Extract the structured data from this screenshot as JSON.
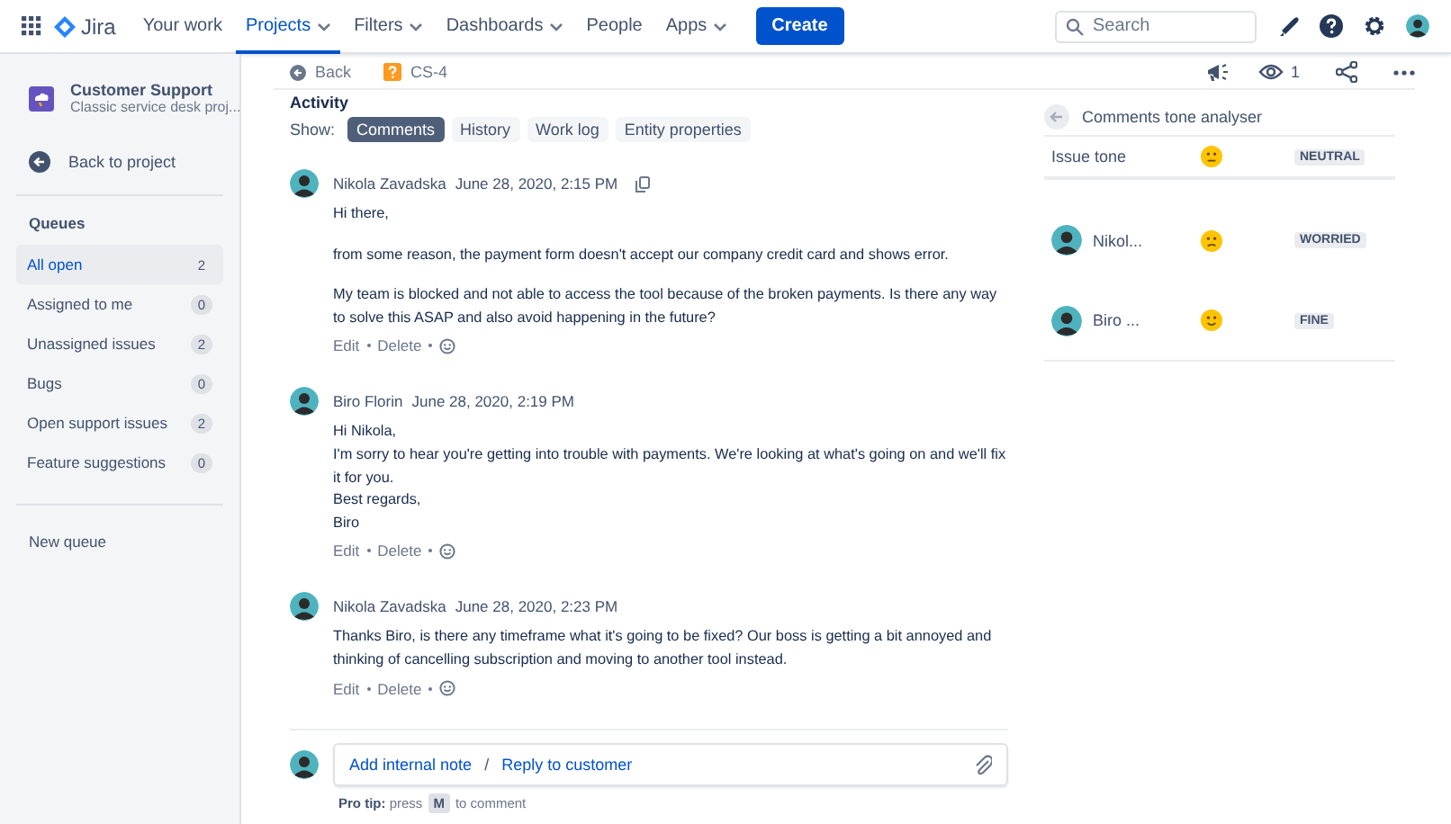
{
  "topnav": {
    "product": "Jira",
    "items": [
      {
        "label": "Your work",
        "selected": false,
        "dropdown": false
      },
      {
        "label": "Projects",
        "selected": true,
        "dropdown": true
      },
      {
        "label": "Filters",
        "selected": false,
        "dropdown": true
      },
      {
        "label": "Dashboards",
        "selected": false,
        "dropdown": true
      },
      {
        "label": "People",
        "selected": false,
        "dropdown": false
      },
      {
        "label": "Apps",
        "selected": false,
        "dropdown": true
      }
    ],
    "create": "Create",
    "search": {
      "placeholder": "Search"
    }
  },
  "sidebar": {
    "project": {
      "name": "Customer Support",
      "type": "Classic service desk proj..."
    },
    "back": "Back to project",
    "queues_heading": "Queues",
    "queues": [
      {
        "label": "All open",
        "count": "2",
        "selected": true
      },
      {
        "label": "Assigned to me",
        "count": "0",
        "selected": false
      },
      {
        "label": "Unassigned issues",
        "count": "2",
        "selected": false
      },
      {
        "label": "Bugs",
        "count": "0",
        "selected": false
      },
      {
        "label": "Open support issues",
        "count": "2",
        "selected": false
      },
      {
        "label": "Feature suggestions",
        "count": "0",
        "selected": false
      }
    ],
    "new_queue": "New queue"
  },
  "issue_bar": {
    "back": "Back",
    "issue_key": "CS-4",
    "watchers": "1"
  },
  "activity": {
    "heading": "Activity",
    "show_label": "Show:",
    "filters": [
      {
        "label": "Comments",
        "selected": true
      },
      {
        "label": "History",
        "selected": false
      },
      {
        "label": "Work log",
        "selected": false
      },
      {
        "label": "Entity properties",
        "selected": false
      }
    ],
    "comments": [
      {
        "author": "Nikola Zavadska",
        "date": "June 28, 2020, 2:15 PM",
        "copy_link": true,
        "paragraphs": [
          [
            "Hi there,"
          ],
          [
            "from some reason, the payment form doesn't accept our company credit card and shows error."
          ],
          [
            "My team is blocked and not able to access the tool because of the broken payments. Is there any way to solve this ASAP and also avoid happening in the future?"
          ]
        ],
        "actions": [
          "Edit",
          "Delete"
        ]
      },
      {
        "author": "Biro Florin",
        "date": "June 28, 2020, 2:19 PM",
        "copy_link": false,
        "paragraphs": [
          [
            "Hi Nikola,",
            "I'm sorry to hear you're getting into trouble with payments. We're looking at what's going on and we'll fix it for you.",
            "Best regards,",
            "Biro"
          ]
        ],
        "actions": [
          "Edit",
          "Delete"
        ]
      },
      {
        "author": "Nikola Zavadska",
        "date": "June 28, 2020, 2:23 PM",
        "copy_link": false,
        "paragraphs": [
          [
            "Thanks Biro, is there any timeframe what it's going to be fixed? Our boss is getting a bit annoyed and thinking of cancelling subscription and moving to another tool instead."
          ]
        ],
        "actions": [
          "Edit",
          "Delete"
        ]
      }
    ],
    "composer": {
      "internal_note": "Add internal note",
      "separator": "/",
      "reply": "Reply to customer"
    },
    "pro_tip": "**Pro tip:** press",
    "pro_tip_key": "M",
    "pro_tip_end": "to comment"
  },
  "tone_panel": {
    "title": "Comments tone analyser",
    "rows": [
      {
        "avatar": false,
        "label": "Issue tone",
        "kind": "neutral",
        "tone": "NEUTRAL"
      },
      {
        "avatar": true,
        "label": "Nikol...",
        "kind": "worried",
        "tone": "WORRIED"
      },
      {
        "avatar": true,
        "label": "Biro ...",
        "kind": "smile",
        "tone": "FINE"
      }
    ]
  }
}
